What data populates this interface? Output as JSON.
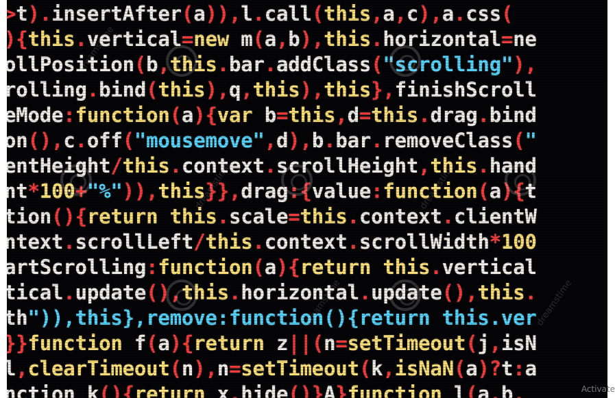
{
  "photo": {
    "description_lines": [
      ">t).insertAfter(a)),l.call(this,a,c),a.css(",
      "){this.vertical=new m(a,b),this.horizontal=ne",
      "ollPosition(b,this.bar.addClass(\"scrolling\"),",
      "rolling.bind(this),q,this),this},finishScroll",
      "eMode:function(a){var b=this,d=this.drag.bind",
      "on(),c.off(\"mousemove\",d),b.bar.removeClass(\"",
      "entHeight/this.context.scrollHeight,this.hand",
      "nt*100+\"%\")),this}},drag:{value:function(a){t",
      "tion(){return this.scale=this.context.clientW",
      "ntext.scrollLeft/this.context.scrollWidth*100",
      "artScrolling:function(a){return this.vertical",
      "tical.update(),this.horizontal.update(),this.",
      "th\")),this},remove:function(){return this.ver",
      "}}function f(a){return z||(n=setTimeout(j,isN",
      "l,clearTimeout(n),n=setTimeout(k,isNaN(a)?t:a",
      "nction k(){return x.hide()}A}function l(a,b,"
    ],
    "colors": {
      "background": "#050507",
      "white": "#f3f0ea",
      "red": "#ff3b3b",
      "cyan": "#57d6ff",
      "yellow": "#ffe27a"
    }
  },
  "watermark_text": "dreamstime",
  "system_notice": "Activate"
}
